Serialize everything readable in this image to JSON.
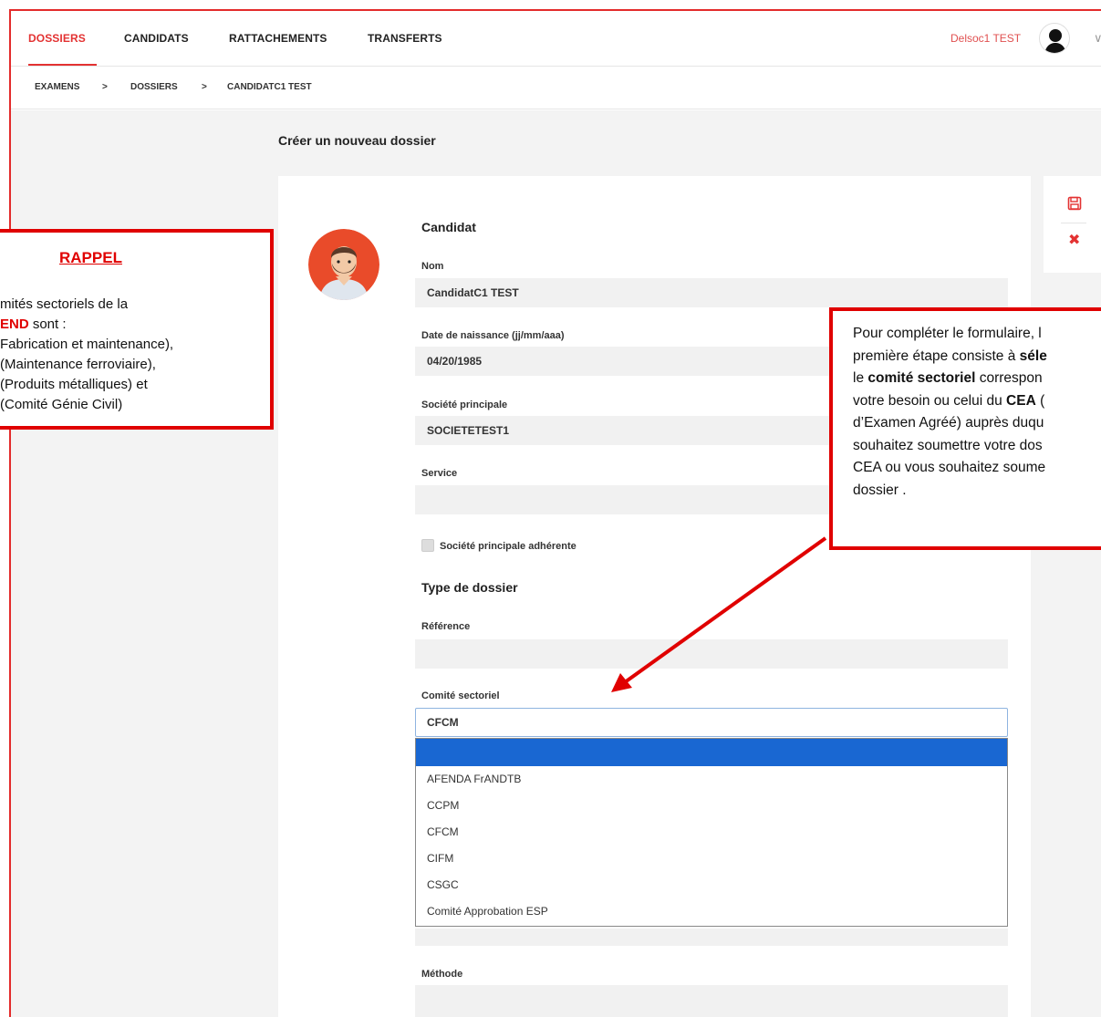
{
  "nav": {
    "tabs": [
      "DOSSIERS",
      "CANDIDATS",
      "RATTACHEMENTS",
      "TRANSFERTS"
    ],
    "active_tab": "DOSSIERS",
    "user_name": "Delsoc1 TEST",
    "chevron": "∨"
  },
  "breadcrumb": {
    "items": [
      "EXAMENS",
      "DOSSIERS",
      "CANDIDATC1 TEST"
    ],
    "separator": ">"
  },
  "page": {
    "title": "Créer un nouveau dossier"
  },
  "actions": {
    "save_icon": "save-icon",
    "close_glyph": "✖"
  },
  "form": {
    "candidat_section": "Candidat",
    "nom_label": "Nom",
    "nom_value": "CandidatC1 TEST",
    "dob_label": "Date de naissance (jj/mm/aaa)",
    "dob_value": "04/20/1985",
    "societe_label": "Société principale",
    "societe_value": "SOCIETETEST1",
    "service_label": "Service",
    "service_value": "",
    "adherente_label": "Société principale adhérente",
    "type_section": "Type de dossier",
    "reference_label": "Référence",
    "reference_value": "",
    "comite_label": "Comité sectoriel",
    "comite_value": "CFCM",
    "comite_options": [
      "",
      "AFENDA FrANDTB",
      "CCPM",
      "CFCM",
      "CIFM",
      "CSGC",
      "Comité Approbation ESP"
    ],
    "methode_label": "Méthode",
    "methode_value": ""
  },
  "callout_left": {
    "title": "RAPPEL",
    "line1": "mités sectoriels de la",
    "line2_red": "END",
    "line2_rest": " sont :",
    "line3": "Fabrication et maintenance),",
    "line4": "(Maintenance ferroviaire),",
    "line5": "(Produits métalliques) et",
    "line6": "(Comité Génie Civil)"
  },
  "callout_right": {
    "l1": "Pour compléter le formulaire, l",
    "l2a": "première étape consiste à ",
    "l2b": "séle",
    "l3a": "le ",
    "l3b": "comité sectoriel",
    "l3c": " correspon",
    "l4a": "votre besoin ou celui du ",
    "l4b": "CEA",
    "l4c": " (",
    "l5": "d’Examen Agréé) auprès duqu",
    "l6": "souhaitez soumettre votre dos",
    "l7": "CEA ou vous souhaitez soume",
    "l8": "dossier  ."
  },
  "colors": {
    "brand_red": "#e33232",
    "callout_red": "#e00000",
    "selected_blue": "#1967d2"
  }
}
